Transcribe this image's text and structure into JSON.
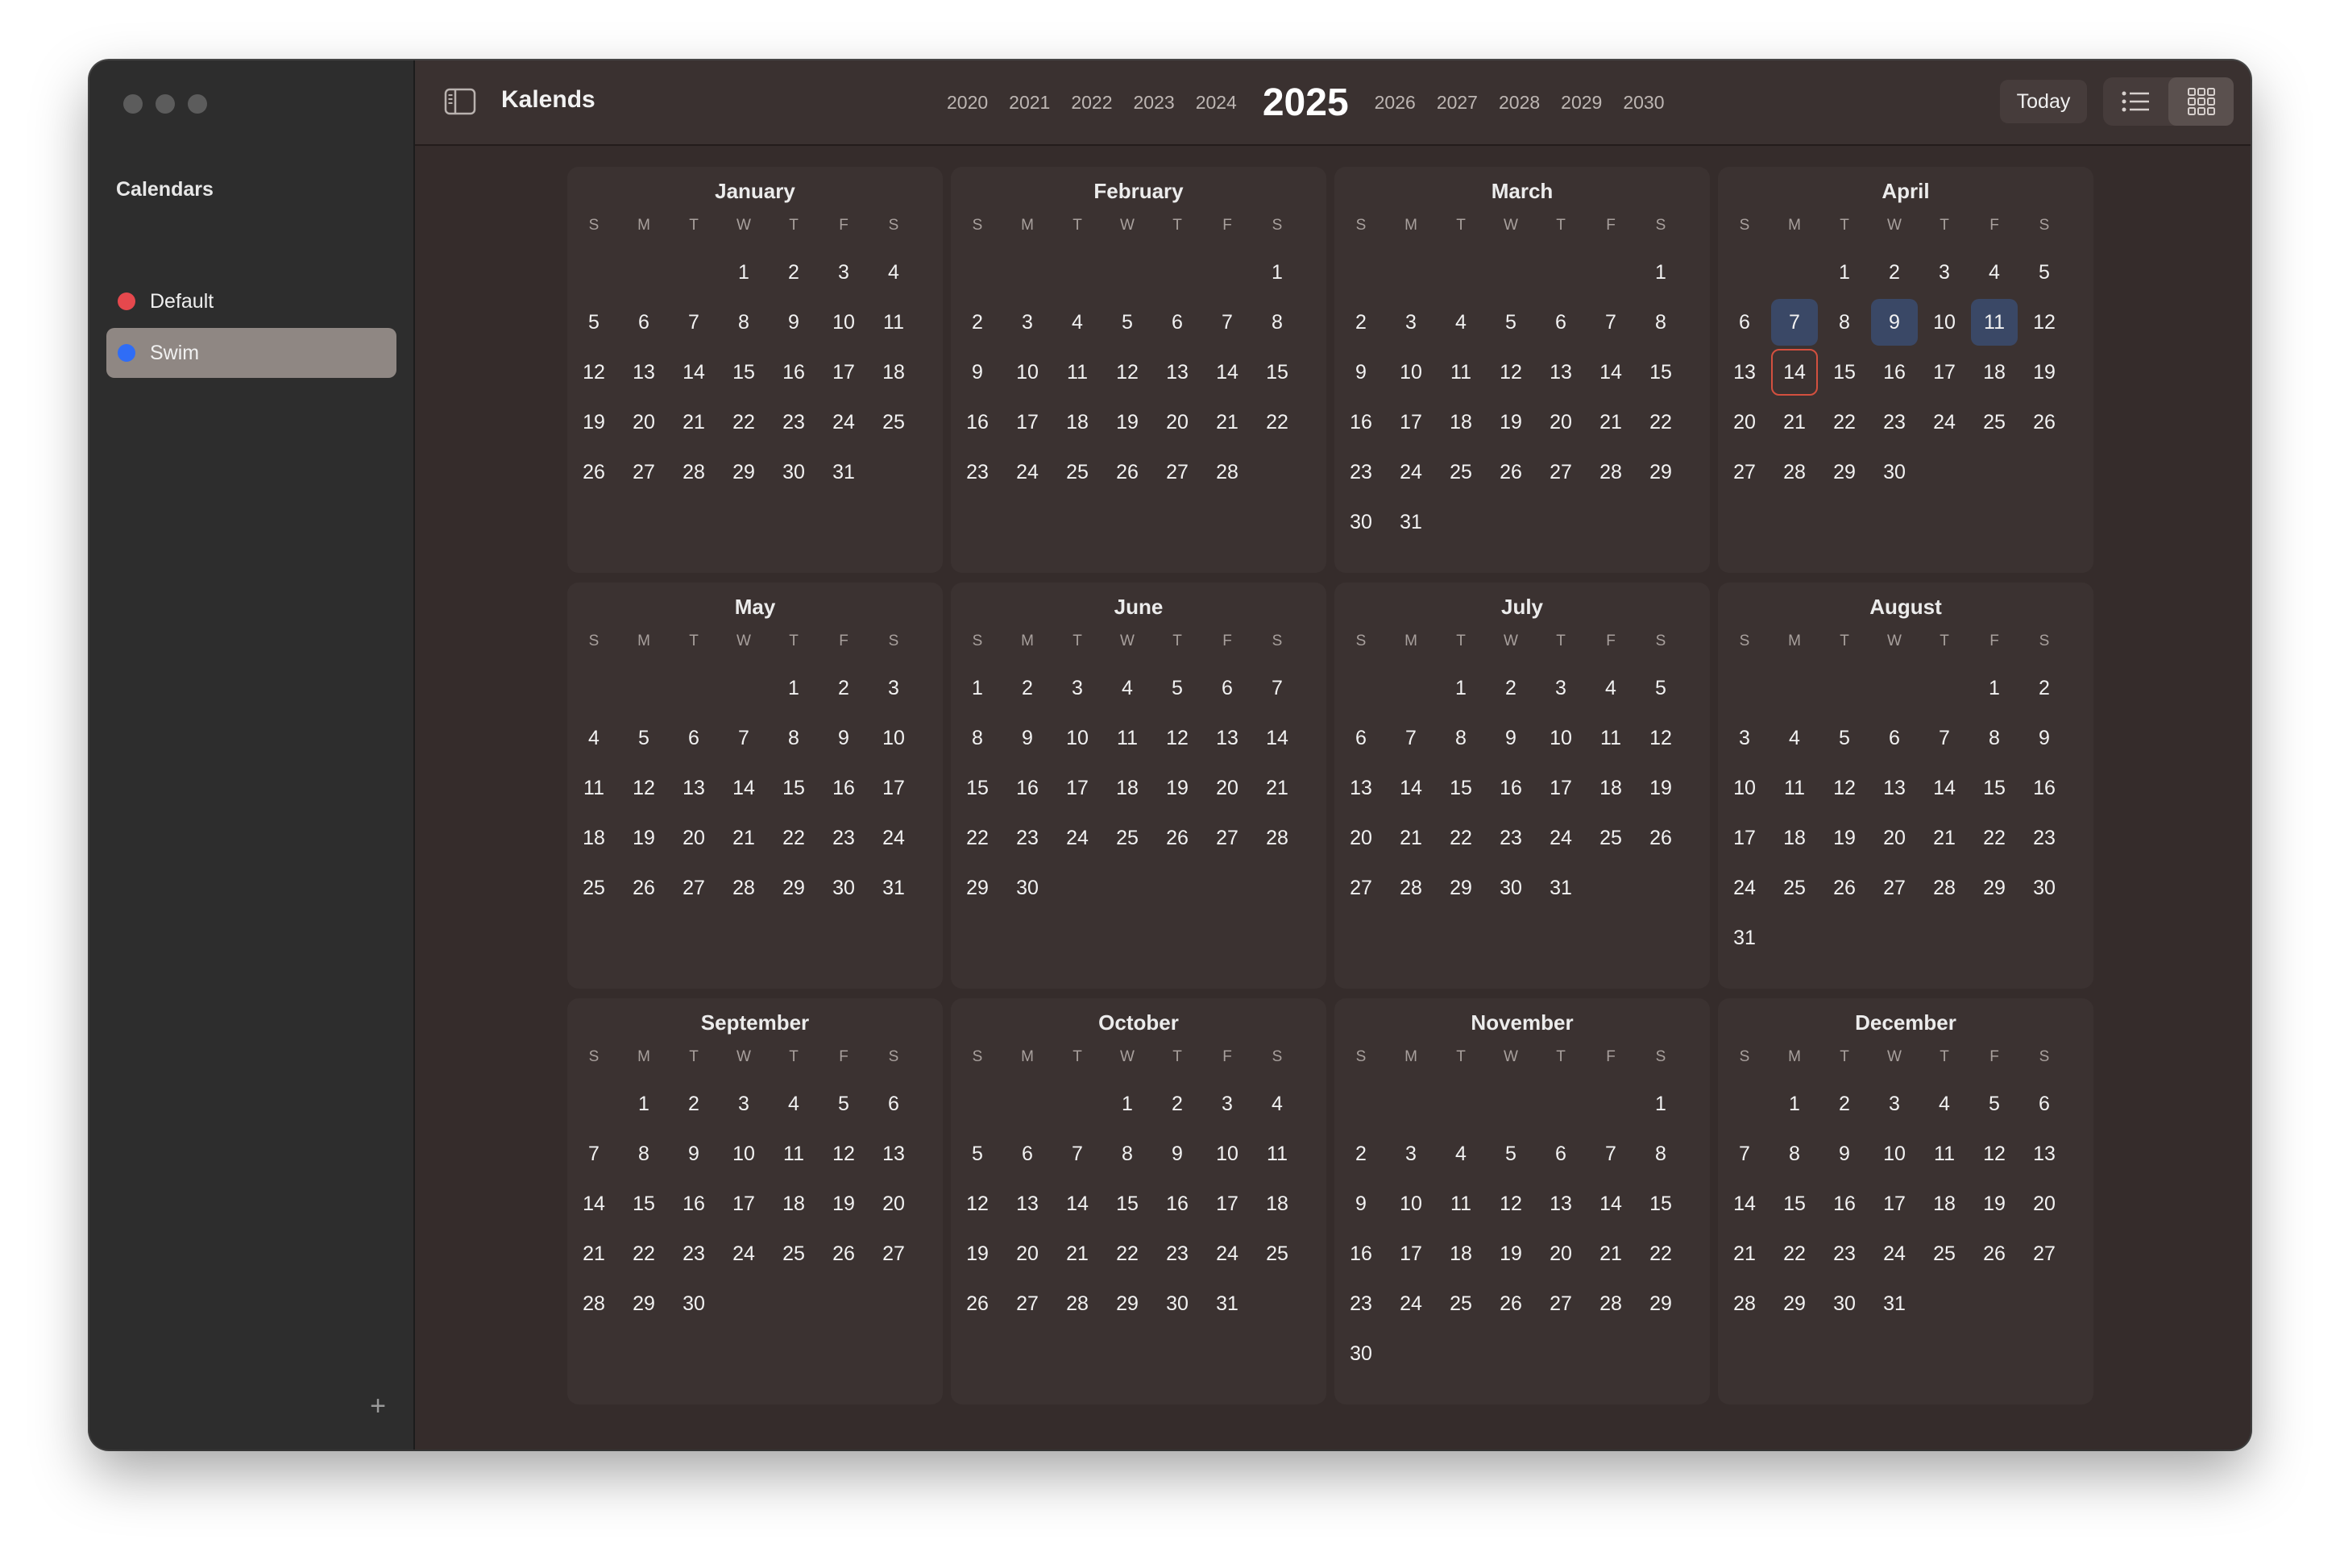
{
  "app": {
    "title": "Kalends"
  },
  "sidebar": {
    "heading": "Calendars",
    "calendars": [
      {
        "name": "Default",
        "color": "#e5484d",
        "selected": false
      },
      {
        "name": "Swim",
        "color": "#2f6df6",
        "selected": true
      }
    ],
    "add_icon": "plus-icon"
  },
  "toolbar": {
    "years": [
      "2020",
      "2021",
      "2022",
      "2023",
      "2024",
      "2025",
      "2026",
      "2027",
      "2028",
      "2029",
      "2030"
    ],
    "current_year": "2025",
    "today_label": "Today",
    "view_modes": [
      "list-view-icon",
      "grid-view-icon"
    ],
    "active_view": "grid"
  },
  "weekday_labels": [
    "S",
    "M",
    "T",
    "W",
    "T",
    "F",
    "S"
  ],
  "months": [
    {
      "name": "January",
      "start": 3,
      "days": 31
    },
    {
      "name": "February",
      "start": 6,
      "days": 28
    },
    {
      "name": "March",
      "start": 6,
      "days": 31
    },
    {
      "name": "April",
      "start": 2,
      "days": 30
    },
    {
      "name": "May",
      "start": 4,
      "days": 31
    },
    {
      "name": "June",
      "start": 0,
      "days": 30
    },
    {
      "name": "July",
      "start": 2,
      "days": 31
    },
    {
      "name": "August",
      "start": 5,
      "days": 31
    },
    {
      "name": "September",
      "start": 1,
      "days": 30
    },
    {
      "name": "October",
      "start": 3,
      "days": 31
    },
    {
      "name": "November",
      "start": 6,
      "days": 30
    },
    {
      "name": "December",
      "start": 1,
      "days": 31
    }
  ],
  "highlights": {
    "today": {
      "month": "April",
      "day": 14
    },
    "event_days": [
      {
        "month": "April",
        "day": 7
      },
      {
        "month": "April",
        "day": 9
      },
      {
        "month": "April",
        "day": 11
      }
    ],
    "event_color": "#3a4866",
    "today_border_color": "#d3503f"
  }
}
